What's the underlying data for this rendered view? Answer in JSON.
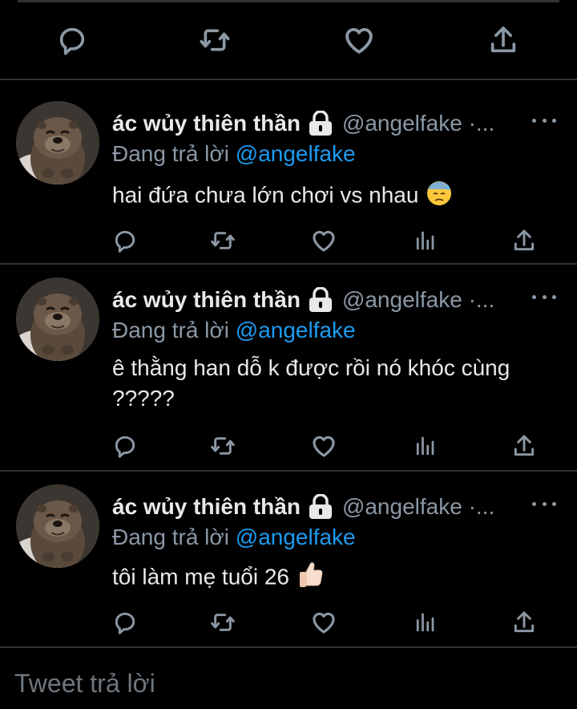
{
  "colors": {
    "background": "#000000",
    "text": "#e7e9ea",
    "muted": "#8b98a5",
    "accent": "#1d9bf0",
    "divider": "#2f3336"
  },
  "top_actions": [
    "reply-icon",
    "retweet-icon",
    "like-icon",
    "share-icon"
  ],
  "tweets": [
    {
      "name": "ác wủy thiên thần",
      "handle": "@angelfake ·...",
      "replying_prefix": "Đang trả lời",
      "replying_to": "@angelfake",
      "text": "hai đứa chưa lớn chơi vs nhau",
      "emoji": "downcast-face-with-sweat"
    },
    {
      "name": "ác wủy thiên thần",
      "handle": "@angelfake ·...",
      "replying_prefix": "Đang trả lời",
      "replying_to": "@angelfake",
      "text": "ê thằng han dỗ k được rồi nó khóc cùng ?????",
      "emoji": ""
    },
    {
      "name": "ác wủy thiên thần",
      "handle": "@angelfake ·...",
      "replying_prefix": "Đang trả lời",
      "replying_to": "@angelfake",
      "text": "tôi làm mẹ tuổi 26",
      "emoji": "thumbs-up-light-skin"
    }
  ],
  "tweet_actions": [
    "reply-icon",
    "retweet-icon",
    "like-icon",
    "analytics-icon",
    "share-icon"
  ],
  "reply_box": {
    "placeholder": "Tweet trả lời"
  }
}
